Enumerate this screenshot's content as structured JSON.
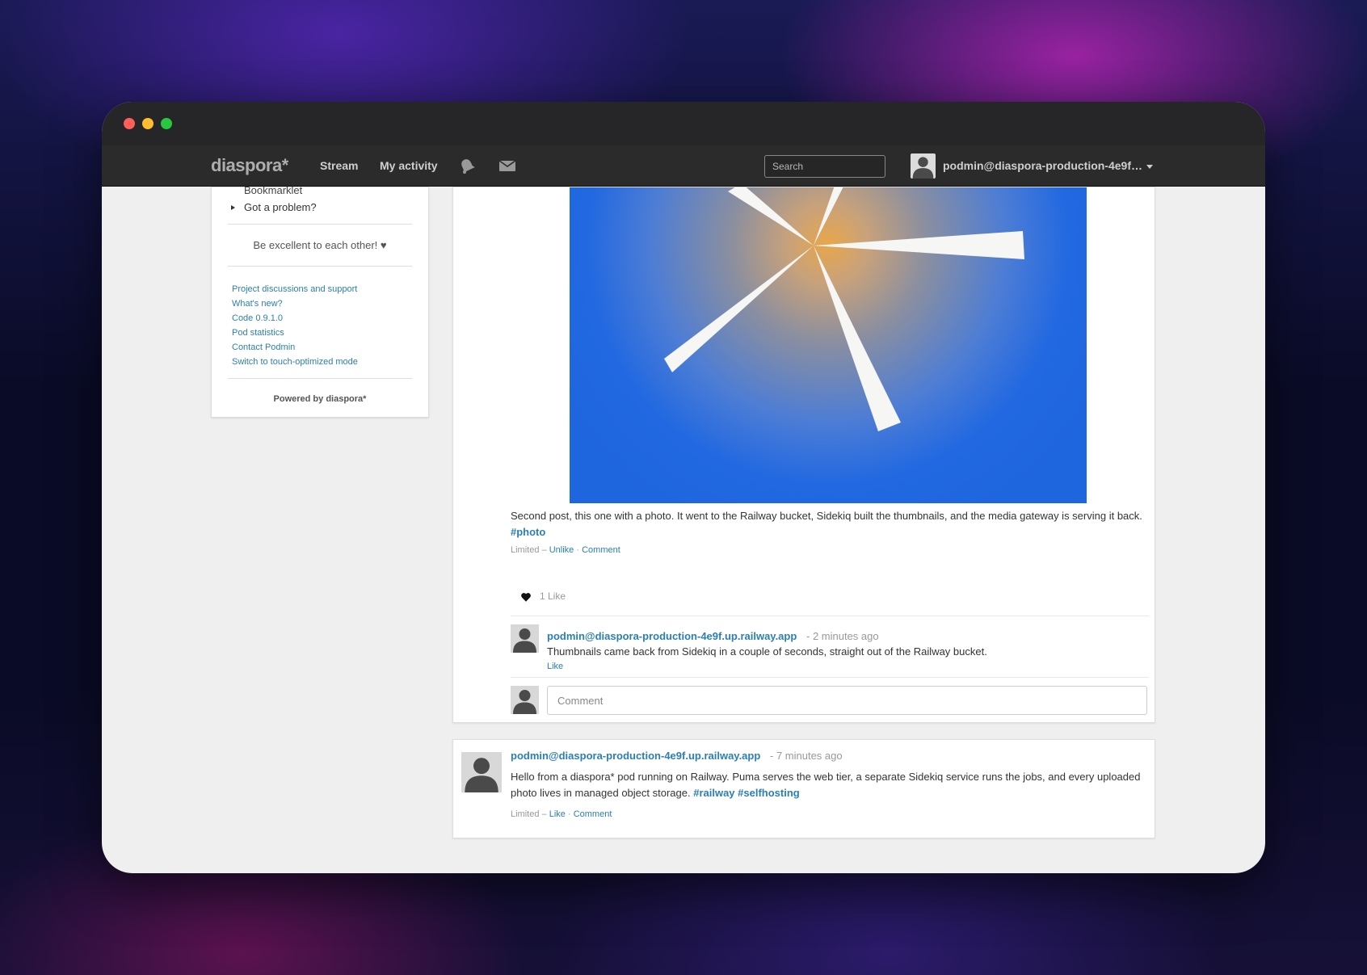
{
  "navbar": {
    "brand": "diaspora*",
    "stream": "Stream",
    "my_activity": "My activity",
    "search_placeholder": "Search",
    "user": "podmin@diaspora-production-4e9f.up..."
  },
  "sidebar": {
    "cut_item": "Bookmarklet",
    "problem": "Got a problem?",
    "motto": "Be excellent to each other! ♥",
    "links": [
      "Project discussions and support",
      "What's new?",
      "Code 0.9.1.0",
      "Pod statistics",
      "Contact Podmin",
      "Switch to touch-optimized mode"
    ],
    "powered": "Powered by diaspora*"
  },
  "post1": {
    "text": "Second post, this one with a photo. It went to the Railway bucket, Sidekiq built the thumbnails, and the media gateway is serving it back.",
    "tag": "#photo",
    "visibility": "Limited",
    "sep1": "–",
    "unlike": "Unlike",
    "sep2": "·",
    "comment": "Comment",
    "likes": "1 Like",
    "comment_author": "podmin@diaspora-production-4e9f.up.railway.app",
    "comment_time": "- 2 minutes ago",
    "comment_text": "Thumbnails came back from Sidekiq in a couple of seconds, straight out of the Railway bucket.",
    "comment_like": "Like",
    "comment_placeholder": "Comment"
  },
  "post2": {
    "author": "podmin@diaspora-production-4e9f.up.railway.app",
    "time": "- 7 minutes ago",
    "text": "Hello from a diaspora* pod running on Railway. Puma serves the web tier, a separate Sidekiq service runs the jobs, and every uploaded photo lives in managed object storage.",
    "tags": "#railway #selfhosting",
    "visibility": "Limited",
    "sep1": "–",
    "like": "Like",
    "sep2": "·",
    "comment": "Comment"
  },
  "colors": {
    "link": "#2a7fb5",
    "navbar": "#2b2b2b",
    "photo_blue": "#1e66dd",
    "photo_orange": "#e8a64a"
  },
  "icons": [
    "bell-icon",
    "envelope-icon",
    "heart-icon",
    "avatar-silhouette-icon",
    "caret-down-icon"
  ]
}
